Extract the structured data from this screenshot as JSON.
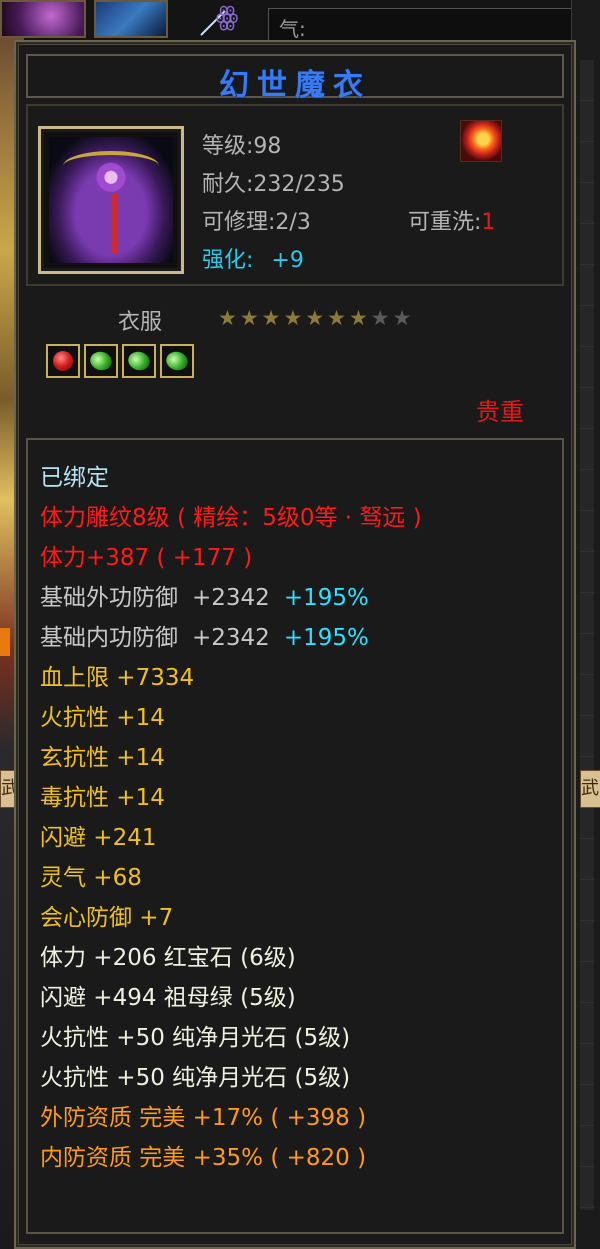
{
  "top_bar": {
    "input_label": "气:"
  },
  "background": {
    "left_button_fragment": "武",
    "right_button_fragment": "武"
  },
  "item": {
    "name": "幻世魔衣",
    "level": "等级:98",
    "durability": "耐久:232/235",
    "repairable": "可修理:2/3",
    "rewash_label": "可重洗:",
    "rewash_value": "1",
    "enhance_label": "强化:",
    "enhance_value": "+9",
    "slot_type": "衣服",
    "stars_filled": 7,
    "stars_total": 9,
    "quality": "贵重",
    "gems": [
      "red-gem",
      "green-gem",
      "green-gem",
      "green-gem"
    ]
  },
  "stats": {
    "bound": "已绑定",
    "engrave": "体力雕纹8级 ( 精绘：5级0等 · 驽远 )",
    "stamina": "体力+387 ( +177 )",
    "outer_def_label": "基础外功防御",
    "outer_def_value": "+2342",
    "outer_def_pct": "+195%",
    "inner_def_label": "基础内功防御",
    "inner_def_value": "+2342",
    "inner_def_pct": "+195%",
    "lines": [
      "血上限  +7334",
      "火抗性  +14",
      "玄抗性  +14",
      "毒抗性  +14",
      "闪避  +241",
      "灵气  +68",
      "会心防御  +7"
    ],
    "gem_lines": [
      "体力  +206  红宝石 (6级)",
      "闪避  +494  祖母绿 (5级)",
      "火抗性  +50  纯净月光石 (5级)",
      "火抗性  +50  纯净月光石 (5级)"
    ],
    "quality_lines": [
      "外防资质    完美  +17% ( +398 )",
      "内防资质    完美  +35% ( +820 )"
    ]
  },
  "colors": {
    "title": "#3a7af0",
    "red": "#ff1a1a",
    "cyan": "#2ee0ff",
    "yellow": "#f0c020",
    "orange": "#ff9a1a"
  }
}
